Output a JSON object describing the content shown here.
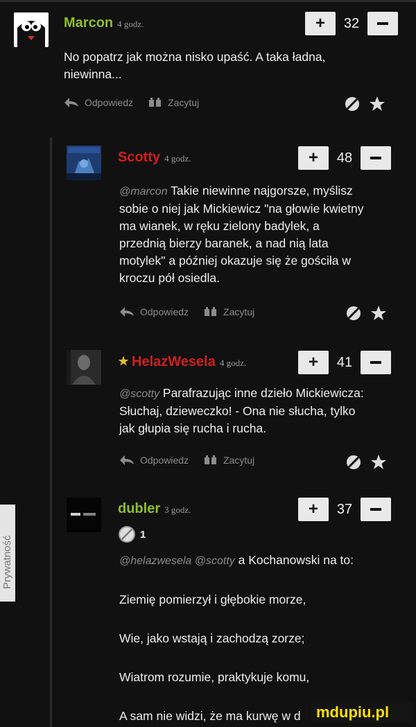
{
  "actions": {
    "reply": "Odpowiedz",
    "quote": "Zacytuj"
  },
  "comments": [
    {
      "username": "Marcon",
      "ago": "4 godz.",
      "score": "32",
      "text_line1": "No popatrz jak można nisko upaść. A taka ładna,",
      "text_line2": "niewinna..."
    },
    {
      "username": "Scotty",
      "ago": "4 godz.",
      "score": "48",
      "mention": "@marcon",
      "text": "Takie niewinne najgorsze, myślisz",
      "text_lines": [
        "sobie o niej jak Mickiewicz \"na głowie kwietny",
        "ma wianek, w ręku zielony badylek, a",
        "przednią bierzy baranek, a nad nią lata",
        "motylek\" a później okazuje się że gościła w",
        "kroczu pół osiedla."
      ]
    },
    {
      "username": "HelazWesela",
      "ago": "4 godz.",
      "score": "41",
      "mention": "@scotty",
      "text": "Parafrazując inne dzieło Mickiewicza:",
      "text_lines": [
        "Słuchaj, dzieweczko! - Ona nie słucha, tylko",
        "jak głupia się rucha i rucha."
      ]
    },
    {
      "username": "dubler",
      "ago": "3 godz.",
      "score": "37",
      "medal_count": "1",
      "mention": "@helazwesela @scotty",
      "text": "a Kochanowski na to:",
      "poem": [
        "Ziemię pomierzył i głębokie morze,",
        "Wie, jako wstają i zachodzą zorze;",
        "Wiatrom rozumie, praktykuje komu,",
        "A sam nie widzi, że ma kurwę w d"
      ]
    }
  ],
  "privacy_label": "Prywatność",
  "watermark": "mdupiu.pl",
  "colors": {
    "accent": "#8ebf2a",
    "helaz_accent": "#d21e1e",
    "background": "#111111"
  }
}
